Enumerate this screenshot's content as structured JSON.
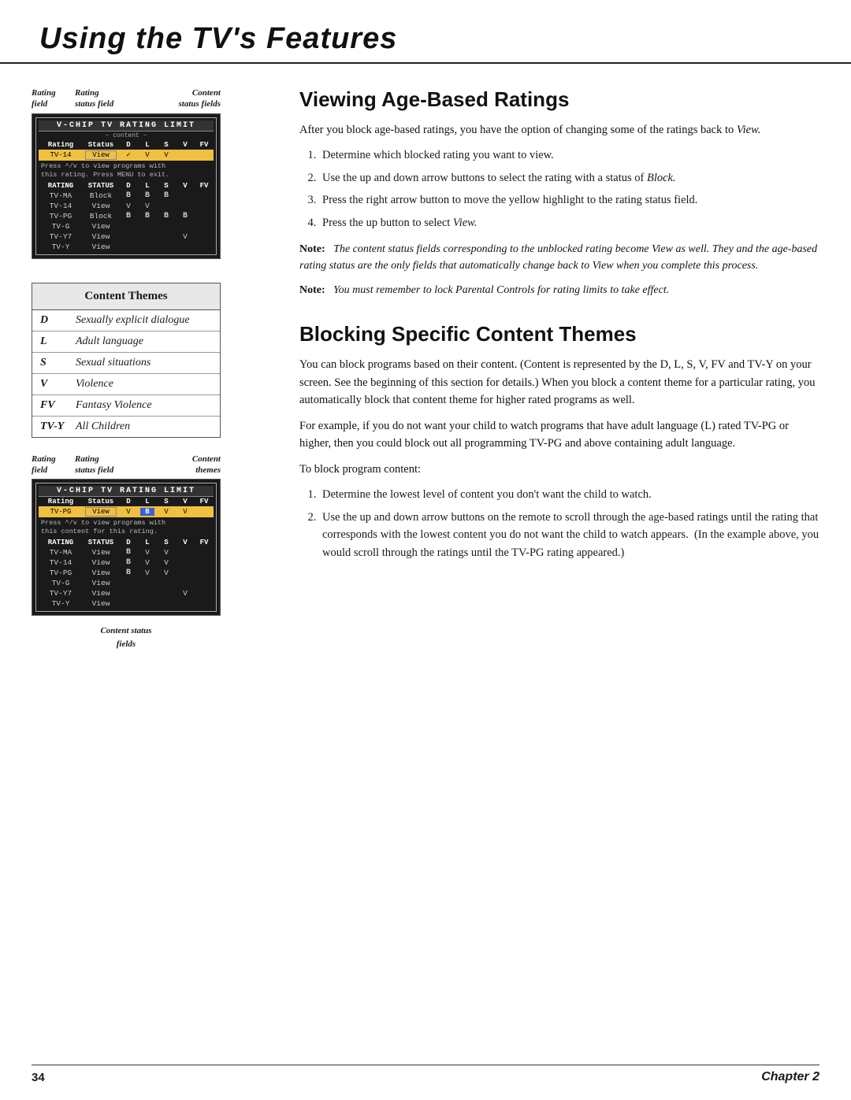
{
  "header": {
    "title": "Using the TV's Features"
  },
  "left_col": {
    "screen1": {
      "labels": {
        "rating": "Rating\nfield",
        "status": "Rating\nstatus field",
        "content": "Content\nstatus fields"
      },
      "title_bar": "V-CHIP TV RATING LIMIT",
      "subtitle": "– content –",
      "col_headers": [
        "Rating",
        "Status",
        "D",
        "L",
        "S",
        "V",
        "FV"
      ],
      "highlighted_row": [
        "TV-14",
        "View",
        "✓",
        "V",
        "V",
        ""
      ],
      "note": "Press ^/v to view programs with\nthis rating. Press MENU to exit.",
      "rows": [
        {
          "rating": "TV-MA",
          "status": "Block",
          "d": "B",
          "l": "B",
          "s": "B",
          "v": "",
          "fv": ""
        },
        {
          "rating": "TV-14",
          "status": "View",
          "d": "V",
          "l": "V",
          "s": "",
          "v": "",
          "fv": ""
        },
        {
          "rating": "TV-PG",
          "status": "Block",
          "d": "B",
          "l": "B",
          "s": "B",
          "v": "B",
          "fv": ""
        },
        {
          "rating": "TV-G",
          "status": "View",
          "d": "",
          "l": "",
          "s": "",
          "v": "",
          "fv": ""
        },
        {
          "rating": "TV-Y7",
          "status": "View",
          "d": "",
          "l": "",
          "s": "",
          "v": "V",
          "fv": ""
        },
        {
          "rating": "TV-Y",
          "status": "View",
          "d": "",
          "l": "",
          "s": "",
          "v": "",
          "fv": ""
        }
      ]
    },
    "content_themes": {
      "header": "Content Themes",
      "rows": [
        {
          "code": "D",
          "desc": "Sexually explicit dialogue"
        },
        {
          "code": "L",
          "desc": "Adult language"
        },
        {
          "code": "S",
          "desc": "Sexual situations"
        },
        {
          "code": "V",
          "desc": "Violence"
        },
        {
          "code": "FV",
          "desc": "Fantasy Violence"
        },
        {
          "code": "TV-Y",
          "desc": "All Children"
        }
      ]
    },
    "screen2": {
      "labels": {
        "rating": "Rating\nfield",
        "status": "Rating\nstatus field",
        "content": "Content\nthemes"
      },
      "title_bar": "V-CHIP TV RATING LIMIT",
      "col_headers": [
        "Rating",
        "Status",
        "D",
        "L",
        "S",
        "V",
        "FV"
      ],
      "highlighted_row": [
        "TV-PG",
        "View",
        "V",
        "B",
        "V",
        "V",
        ""
      ],
      "note": "Press ^/v to view programs with\nthis content for this rating.",
      "rows": [
        {
          "rating": "TV-MA",
          "status": "View",
          "d": "B",
          "l": "V",
          "s": "V",
          "v": "",
          "fv": ""
        },
        {
          "rating": "TV-14",
          "status": "View",
          "d": "B",
          "l": "V",
          "s": "V",
          "v": "",
          "fv": ""
        },
        {
          "rating": "TV-PG",
          "status": "View",
          "d": "B",
          "l": "V",
          "s": "V",
          "v": "",
          "fv": ""
        },
        {
          "rating": "TV-G",
          "status": "View",
          "d": "",
          "l": "",
          "s": "",
          "v": "",
          "fv": ""
        },
        {
          "rating": "TV-Y7",
          "status": "View",
          "d": "",
          "l": "",
          "s": "",
          "v": "V",
          "fv": ""
        },
        {
          "rating": "TV-Y",
          "status": "View",
          "d": "",
          "l": "",
          "s": "",
          "v": "",
          "fv": ""
        }
      ],
      "bottom_label": "Content status\nfields"
    }
  },
  "right_col": {
    "section1": {
      "title": "Viewing Age-Based Ratings",
      "intro": "After you block age-based ratings, you have the option of changing some of the ratings back to View.",
      "steps": [
        "Determine which blocked rating you want to view.",
        "Use the up and down arrow buttons to select the rating with a status of Block.",
        "Press the right arrow button to move the yellow highlight to the rating status field.",
        "Press the up button to select View."
      ],
      "note1": "The content status fields corresponding to the unblocked rating become View as well. They and the age-based rating status are the only fields that automatically change back to View when you complete this process.",
      "note1_label": "Note:",
      "note2": "You must remember to lock Parental Controls for rating limits to take effect.",
      "note2_label": "Note:"
    },
    "section2": {
      "title": "Blocking Specific Content Themes",
      "para1": "You can block programs based on their content. (Content is represented by the D, L, S, V, FV and TV-Y on your screen. See the beginning of this section for details.) When you block a content theme for a particular rating, you automatically block that content theme for higher rated programs as well.",
      "para2": "For example, if you do not want your child to watch programs that have adult language (L) rated TV-PG or higher, then you could block out all programming TV-PG and above containing adult language.",
      "intro_steps": "To block program content:",
      "steps": [
        "Determine the lowest level of content you don't want the child to watch.",
        "Use the up and down arrow buttons on the remote to scroll through the age-based ratings until the rating that corresponds with the lowest content you do not want the child to watch appears.  (In the example above, you would scroll through the ratings until the TV-PG rating appeared.)"
      ]
    }
  },
  "footer": {
    "page_num": "34",
    "chapter": "Chapter 2"
  }
}
